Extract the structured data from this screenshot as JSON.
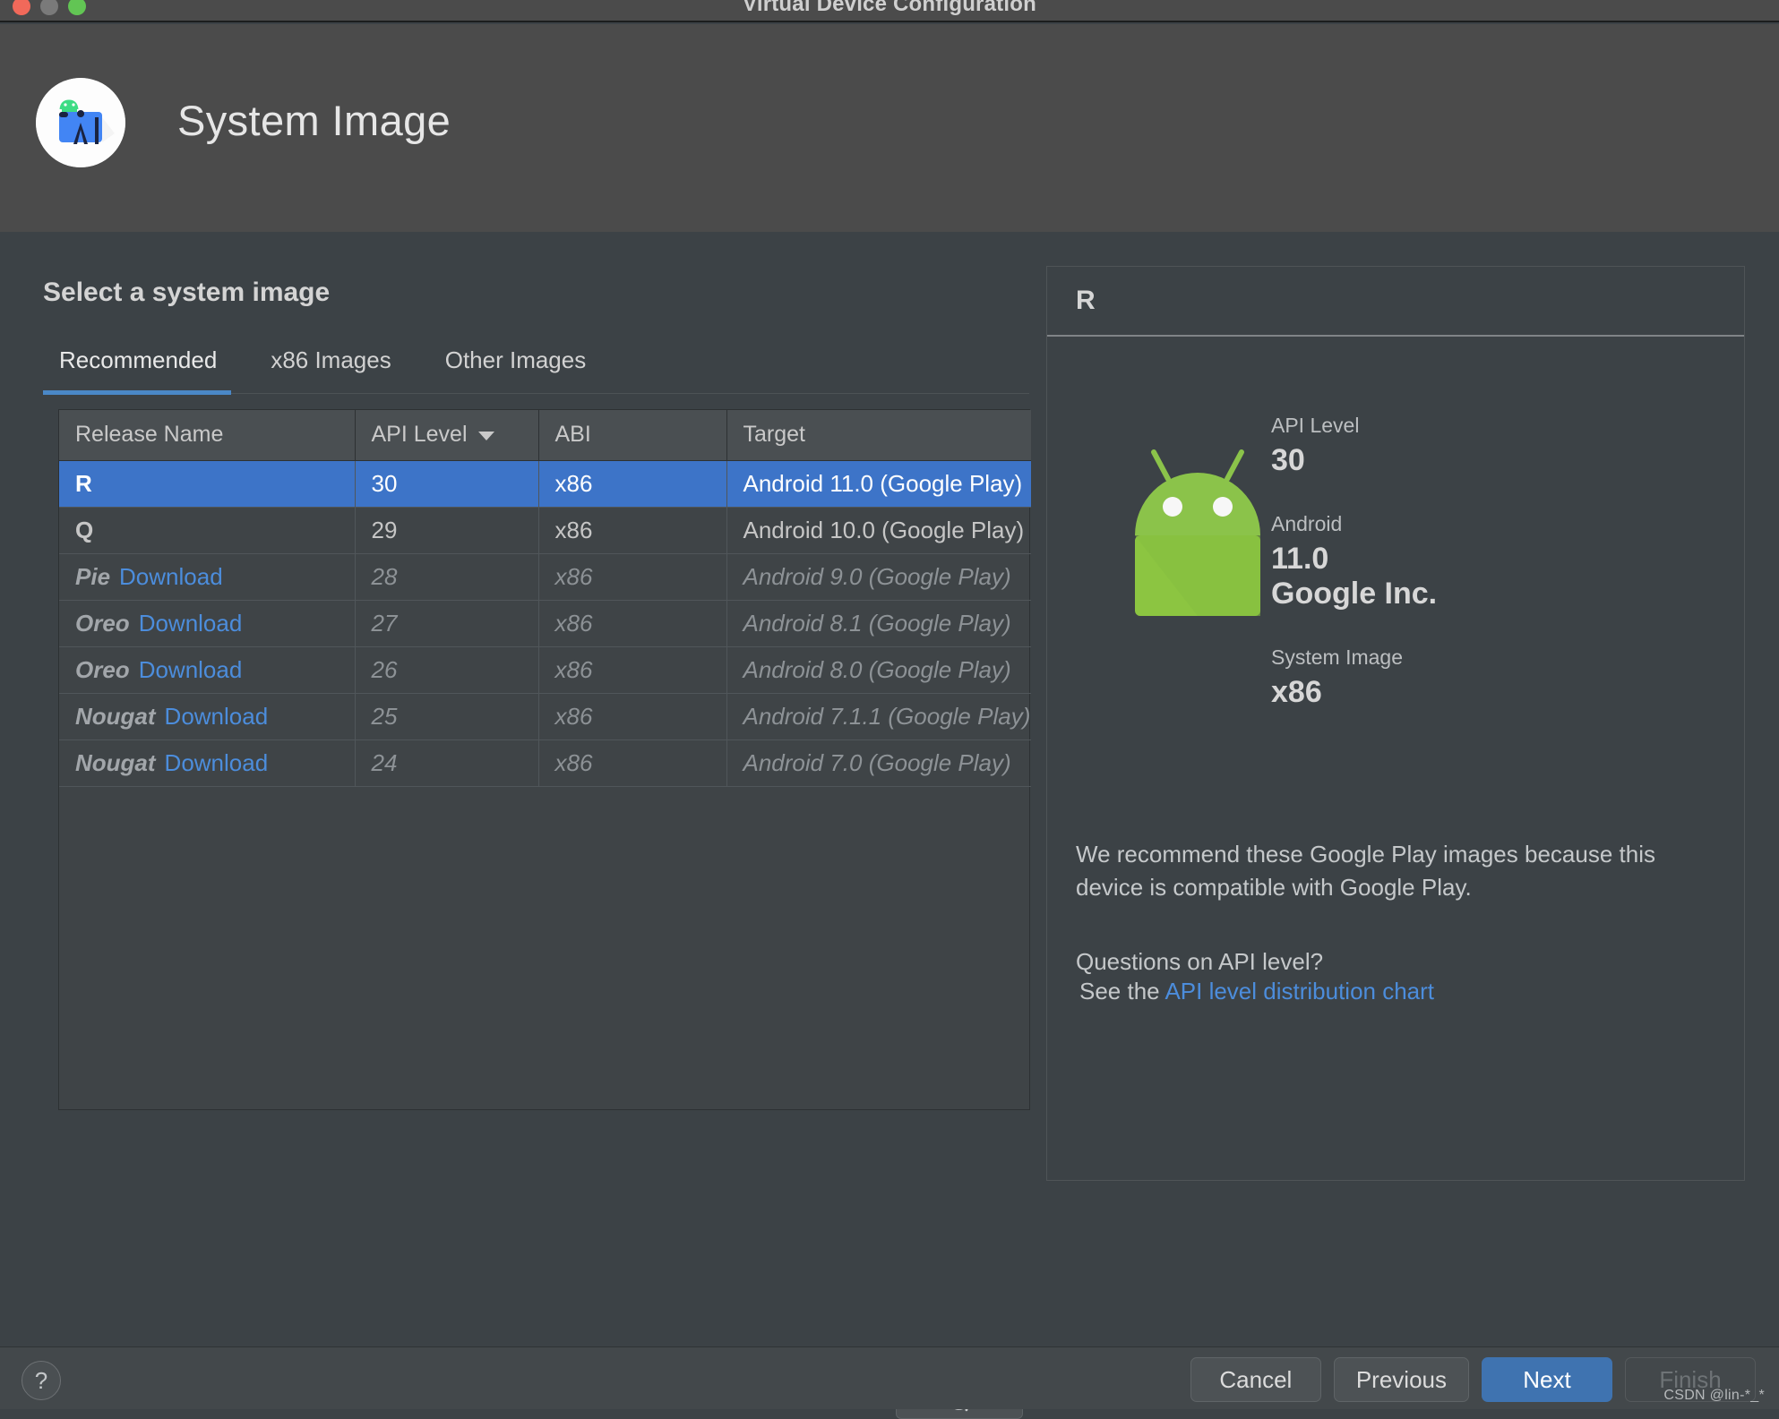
{
  "window": {
    "title": "Virtual Device Configuration",
    "controls": [
      "close",
      "minimize",
      "zoom"
    ]
  },
  "wizard": {
    "title": "System Image",
    "logo_alt": "android-studio-logo"
  },
  "main": {
    "section_title": "Select a system image",
    "tabs": [
      {
        "label": "Recommended",
        "active": true
      },
      {
        "label": "x86 Images",
        "active": false
      },
      {
        "label": "Other Images",
        "active": false
      }
    ],
    "table": {
      "columns": [
        "Release Name",
        "API Level",
        "ABI",
        "Target"
      ],
      "sorted_column": "API Level",
      "sort_direction": "desc",
      "rows": [
        {
          "release": "R",
          "download": "",
          "api": "30",
          "abi": "x86",
          "target": "Android 11.0 (Google Play)",
          "selected": true,
          "installed": true
        },
        {
          "release": "Q",
          "download": "",
          "api": "29",
          "abi": "x86",
          "target": "Android 10.0 (Google Play)",
          "selected": false,
          "installed": true
        },
        {
          "release": "Pie",
          "download": "Download",
          "api": "28",
          "abi": "x86",
          "target": "Android 9.0 (Google Play)",
          "selected": false,
          "installed": false
        },
        {
          "release": "Oreo",
          "download": "Download",
          "api": "27",
          "abi": "x86",
          "target": "Android 8.1 (Google Play)",
          "selected": false,
          "installed": false
        },
        {
          "release": "Oreo",
          "download": "Download",
          "api": "26",
          "abi": "x86",
          "target": "Android 8.0 (Google Play)",
          "selected": false,
          "installed": false
        },
        {
          "release": "Nougat",
          "download": "Download",
          "api": "25",
          "abi": "x86",
          "target": "Android 7.1.1 (Google Play)",
          "selected": false,
          "installed": false
        },
        {
          "release": "Nougat",
          "download": "Download",
          "api": "24",
          "abi": "x86",
          "target": "Android 7.0 (Google Play)",
          "selected": false,
          "installed": false
        }
      ]
    },
    "refresh_icon": "refresh-icon"
  },
  "detail": {
    "heading": "R",
    "image_alt": "android-robot-icon",
    "fields": [
      {
        "label": "API Level",
        "value": "30"
      },
      {
        "label": "Android",
        "value": "11.0"
      },
      {
        "label": "",
        "value": "Google Inc."
      },
      {
        "label": "System Image",
        "value": "x86"
      }
    ],
    "note": "We recommend these Google Play images because this device is compatible with Google Play.",
    "question": "Questions on API level?",
    "see_prefix": "See the",
    "chart_link": "API level distribution chart"
  },
  "footer": {
    "help_label": "?",
    "buttons": [
      {
        "label": "Cancel",
        "style": "normal"
      },
      {
        "label": "Previous",
        "style": "normal"
      },
      {
        "label": "Next",
        "style": "primary"
      },
      {
        "label": "Finish",
        "style": "disabled"
      }
    ],
    "watermark": "CSDN @lin-*_*"
  },
  "colors": {
    "header_bg": "#4b4b4b",
    "body_bg": "#3c4246",
    "selection_blue": "#3d74c8",
    "link_blue": "#4c8ddc",
    "primary_button": "#3f73b0",
    "tab_underline": "#4a88c7",
    "android_green": "#8bc34a"
  }
}
